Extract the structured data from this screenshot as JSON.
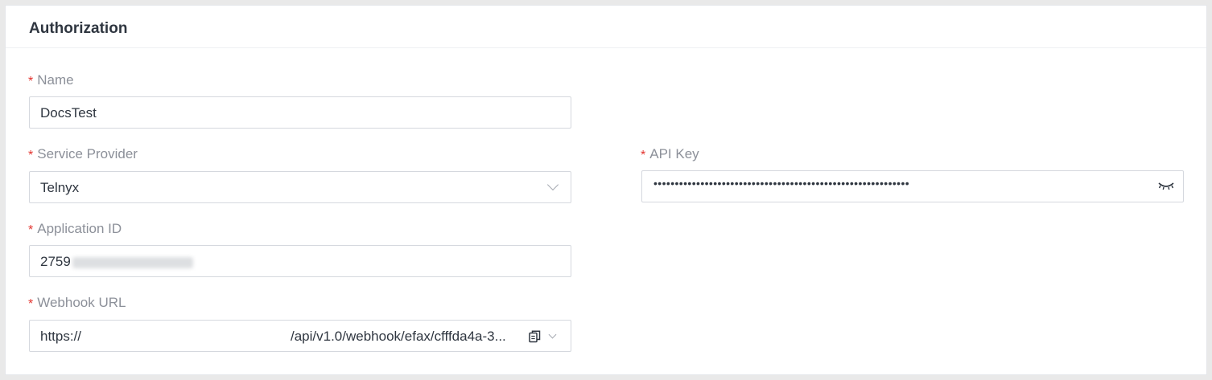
{
  "card": {
    "title": "Authorization"
  },
  "fields": {
    "name": {
      "label": "Name",
      "required_mark": "*",
      "value": "DocsTest"
    },
    "service_provider": {
      "label": "Service Provider",
      "required_mark": "*",
      "selected": "Telnyx"
    },
    "api_key": {
      "label": "API Key",
      "required_mark": "*",
      "masked_value": "••••••••••••••••••••••••••••••••••••••••••••••••••••••••••••",
      "toggle_icon": "eye-closed-icon"
    },
    "application_id": {
      "label": "Application ID",
      "required_mark": "*",
      "value_prefix": "2759"
    },
    "webhook_url": {
      "label": "Webhook URL",
      "required_mark": "*",
      "value_start": "https://",
      "value_end": "/api/v1.0/webhook/efax/cfffda4a-3...",
      "copy_icon": "copy-icon",
      "dropdown_icon": "chevron-down-icon"
    }
  },
  "colors": {
    "required": "#e3342f",
    "label": "#8c9099",
    "text": "#2f3640",
    "border": "#d5d8de"
  }
}
